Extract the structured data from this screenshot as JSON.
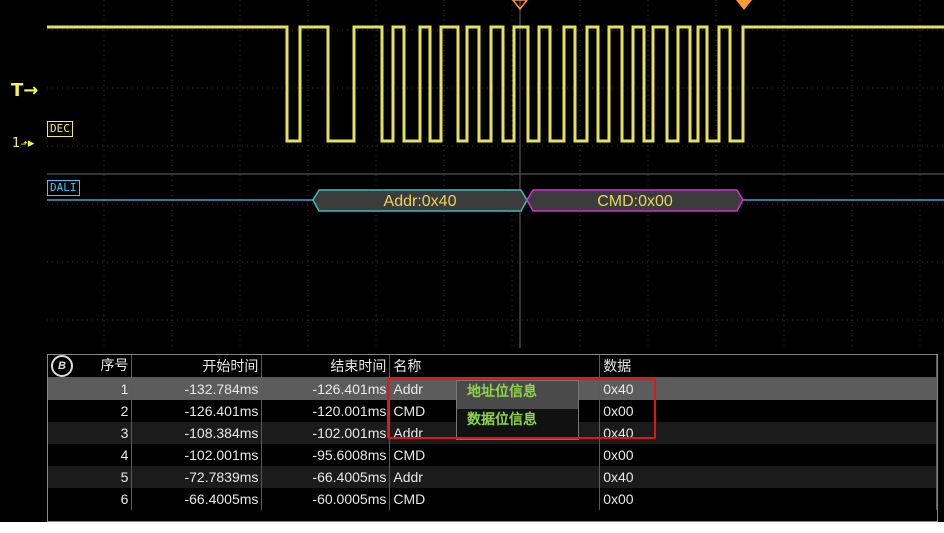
{
  "channel_labels": {
    "trigger": "T",
    "ch1": "1",
    "dec_tag": "DEC",
    "dali_tag": "DALI"
  },
  "decode_packets": [
    {
      "label": "Addr:0x40",
      "color": "#3fbac0"
    },
    {
      "label": "CMD:0x00",
      "color": "#d52fd4"
    }
  ],
  "colors": {
    "ch1": "#e6e15a",
    "bus": "#3aa6d8",
    "trigger_marker": "#ff9933",
    "highlight": "#e01515"
  },
  "table": {
    "badge": "B",
    "headers": [
      "序号",
      "开始时间",
      "结束时间",
      "名称",
      "",
      "数据"
    ],
    "rows": [
      {
        "index": "1",
        "start": "-132.784ms",
        "end": "-126.401ms",
        "name": "Addr",
        "data": "0x40"
      },
      {
        "index": "2",
        "start": "-126.401ms",
        "end": "-120.001ms",
        "name": "CMD",
        "data": "0x00"
      },
      {
        "index": "3",
        "start": "-108.384ms",
        "end": "-102.001ms",
        "name": "Addr",
        "data": "0x40"
      },
      {
        "index": "4",
        "start": "-102.001ms",
        "end": "-95.6008ms",
        "name": "CMD",
        "data": "0x00"
      },
      {
        "index": "5",
        "start": "-72.7839ms",
        "end": "-66.4005ms",
        "name": "Addr",
        "data": "0x40"
      },
      {
        "index": "6",
        "start": "-66.4005ms",
        "end": "-60.0005ms",
        "name": "CMD",
        "data": "0x00"
      }
    ]
  },
  "popup": {
    "items": [
      "地址位信息",
      "数据位信息"
    ]
  }
}
